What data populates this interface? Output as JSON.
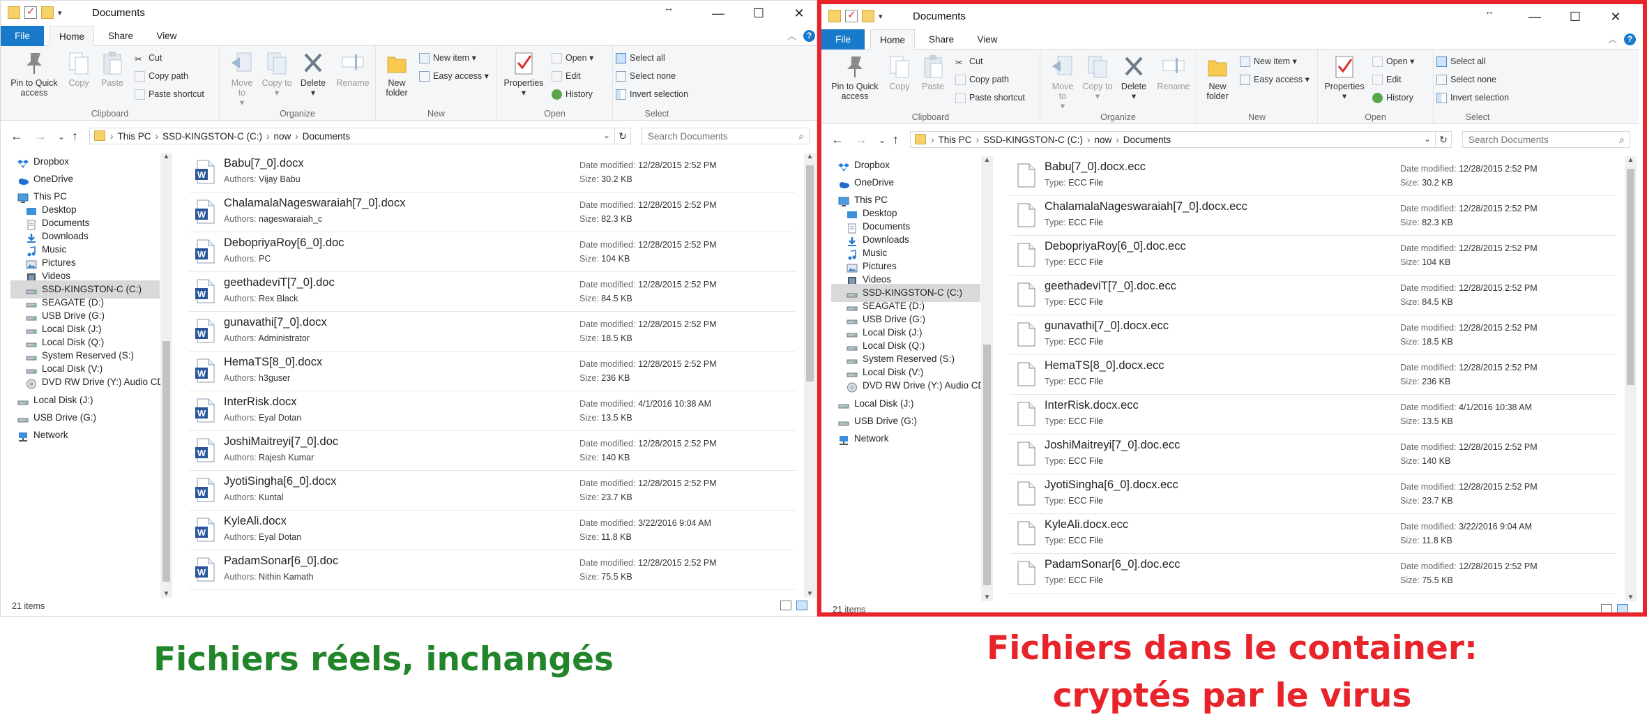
{
  "window": {
    "title": "Documents",
    "tabs": [
      "File",
      "Home",
      "Share",
      "View"
    ],
    "help": "?"
  },
  "ribbon": {
    "clipboard": {
      "label": "Clipboard",
      "pin": "Pin to Quick access",
      "copy": "Copy",
      "paste": "Paste",
      "cut": "Cut",
      "copy_path": "Copy path",
      "paste_shortcut": "Paste shortcut"
    },
    "organize": {
      "label": "Organize",
      "move_to": "Move to",
      "copy_to": "Copy to",
      "delete": "Delete",
      "rename": "Rename"
    },
    "new": {
      "label": "New",
      "new_folder": "New folder",
      "new_item": "New item",
      "easy_access": "Easy access"
    },
    "open": {
      "label": "Open",
      "properties": "Properties",
      "open": "Open",
      "edit": "Edit",
      "history": "History"
    },
    "select": {
      "label": "Select",
      "select_all": "Select all",
      "select_none": "Select none",
      "invert": "Invert selection"
    }
  },
  "address": {
    "crumbs": [
      "This PC",
      "SSD-KINGSTON-C (C:)",
      "now",
      "Documents"
    ],
    "search_placeholder": "Search Documents"
  },
  "nav": [
    {
      "label": "Dropbox",
      "icon": "dropbox-icon",
      "indent": 0
    },
    {
      "label": "OneDrive",
      "icon": "onedrive-icon",
      "indent": 0
    },
    {
      "label": "This PC",
      "icon": "this-pc-icon",
      "indent": 0
    },
    {
      "label": "Desktop",
      "icon": "desktop-icon",
      "indent": 1
    },
    {
      "label": "Documents",
      "icon": "documents-icon",
      "indent": 1
    },
    {
      "label": "Downloads",
      "icon": "downloads-icon",
      "indent": 1
    },
    {
      "label": "Music",
      "icon": "music-icon",
      "indent": 1
    },
    {
      "label": "Pictures",
      "icon": "pictures-icon",
      "indent": 1
    },
    {
      "label": "Videos",
      "icon": "videos-icon",
      "indent": 1
    },
    {
      "label": "SSD-KINGSTON-C (C:)",
      "icon": "drive-icon",
      "indent": 1,
      "selected": true
    },
    {
      "label": "SEAGATE (D:)",
      "icon": "drive-icon",
      "indent": 1
    },
    {
      "label": "USB Drive (G:)",
      "icon": "drive-icon",
      "indent": 1
    },
    {
      "label": "Local Disk (J:)",
      "icon": "drive-icon",
      "indent": 1
    },
    {
      "label": "Local Disk (Q:)",
      "icon": "drive-icon",
      "indent": 1
    },
    {
      "label": "System Reserved (S:)",
      "icon": "drive-icon",
      "indent": 1
    },
    {
      "label": "Local Disk (V:)",
      "icon": "drive-icon",
      "indent": 1
    },
    {
      "label": "DVD RW Drive (Y:) Audio CD",
      "icon": "dvd-icon",
      "indent": 1
    },
    {
      "label": "Local Disk (J:)",
      "icon": "drive-icon",
      "indent": 0
    },
    {
      "label": "USB Drive (G:)",
      "icon": "drive-icon",
      "indent": 0
    },
    {
      "label": "Network",
      "icon": "network-icon",
      "indent": 0
    }
  ],
  "labels": {
    "authors": "Authors:",
    "type": "Type:",
    "date_modified": "Date modified:",
    "size": "Size:",
    "ecc_type": "ECC File"
  },
  "files": [
    {
      "name": "Babu[7_0].docx",
      "author": "Vijay Babu",
      "date": "12/28/2015 2:52 PM",
      "size": "30.2 KB"
    },
    {
      "name": "ChalamalaNageswaraiah[7_0].docx",
      "author": "nageswaraiah_c",
      "date": "12/28/2015 2:52 PM",
      "size": "82.3 KB"
    },
    {
      "name": "DebopriyaRoy[6_0].doc",
      "author": "PC",
      "date": "12/28/2015 2:52 PM",
      "size": "104 KB"
    },
    {
      "name": "geethadeviT[7_0].doc",
      "author": "Rex Black",
      "date": "12/28/2015 2:52 PM",
      "size": "84.5 KB"
    },
    {
      "name": "gunavathi[7_0].docx",
      "author": "Administrator",
      "date": "12/28/2015 2:52 PM",
      "size": "18.5 KB"
    },
    {
      "name": "HemaTS[8_0].docx",
      "author": "h3guser",
      "date": "12/28/2015 2:52 PM",
      "size": "236 KB"
    },
    {
      "name": "InterRisk.docx",
      "author": "Eyal Dotan",
      "date": "4/1/2016 10:38 AM",
      "size": "13.5 KB"
    },
    {
      "name": "JoshiMaitreyi[7_0].doc",
      "author": "Rajesh Kumar",
      "date": "12/28/2015 2:52 PM",
      "size": "140 KB"
    },
    {
      "name": "JyotiSingha[6_0].docx",
      "author": "Kuntal",
      "date": "12/28/2015 2:52 PM",
      "size": "23.7 KB"
    },
    {
      "name": "KyleAli.docx",
      "author": "Eyal Dotan",
      "date": "3/22/2016 9:04 AM",
      "size": "11.8 KB"
    },
    {
      "name": "PadamSonar[6_0].doc",
      "author": "Nithin Kamath",
      "date": "12/28/2015 2:52 PM",
      "size": "75.5 KB"
    }
  ],
  "ecc_files": [
    {
      "name": "Babu[7_0].docx.ecc",
      "date": "12/28/2015 2:52 PM",
      "size": "30.2 KB"
    },
    {
      "name": "ChalamalaNageswaraiah[7_0].docx.ecc",
      "date": "12/28/2015 2:52 PM",
      "size": "82.3 KB"
    },
    {
      "name": "DebopriyaRoy[6_0].doc.ecc",
      "date": "12/28/2015 2:52 PM",
      "size": "104 KB"
    },
    {
      "name": "geethadeviT[7_0].doc.ecc",
      "date": "12/28/2015 2:52 PM",
      "size": "84.5 KB"
    },
    {
      "name": "gunavathi[7_0].docx.ecc",
      "date": "12/28/2015 2:52 PM",
      "size": "18.5 KB"
    },
    {
      "name": "HemaTS[8_0].docx.ecc",
      "date": "12/28/2015 2:52 PM",
      "size": "236 KB"
    },
    {
      "name": "InterRisk.docx.ecc",
      "date": "4/1/2016 10:38 AM",
      "size": "13.5 KB"
    },
    {
      "name": "JoshiMaitreyi[7_0].doc.ecc",
      "date": "12/28/2015 2:52 PM",
      "size": "140 KB"
    },
    {
      "name": "JyotiSingha[6_0].docx.ecc",
      "date": "12/28/2015 2:52 PM",
      "size": "23.7 KB"
    },
    {
      "name": "KyleAli.docx.ecc",
      "date": "3/22/2016 9:04 AM",
      "size": "11.8 KB"
    },
    {
      "name": "PadamSonar[6_0].doc.ecc",
      "date": "12/28/2015 2:52 PM",
      "size": "75.5 KB"
    }
  ],
  "status": {
    "item_count": "21 items"
  },
  "captions": {
    "left": "Fichiers réels, inchangés",
    "right_line1": "Fichiers dans le container:",
    "right_line2": "cryptés par le virus"
  },
  "colors": {
    "accent": "#1979ca",
    "highlight_border": "#e8232a",
    "caption_left": "#22852a",
    "caption_right": "#e8232a"
  }
}
